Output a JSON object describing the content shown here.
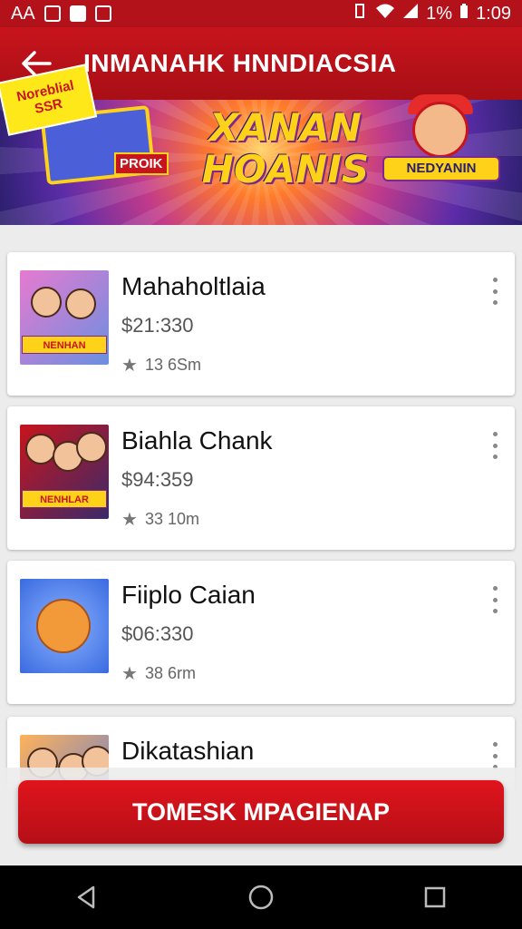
{
  "status_bar": {
    "left_text": "AA",
    "time": "1:09",
    "signal_text": "ᵴ",
    "battery_text": "1%"
  },
  "app_bar": {
    "title": "INMANAHK HNNDIACSIA"
  },
  "banner": {
    "tag_text": "Noreblial SSR",
    "title_line1": "XANAN",
    "title_line2": "HOANIS",
    "tv_label": "PROIK",
    "ribbon_text": "NEDYANIN",
    "colors": {
      "primary": "#c8141c",
      "gold": "#ffd21a",
      "purple": "#5b2ca8"
    }
  },
  "items": [
    {
      "title": "Mahaholtlaia",
      "price": "$21:330",
      "meta": "13 6Sm",
      "thumb_badge": "NENHAN",
      "thumb_bg": "#6b8fe0"
    },
    {
      "title": "Biahla Chank",
      "price": "$94:359",
      "meta": "33 10m",
      "thumb_badge": "NENHLAR",
      "thumb_bg": "#3a2a6a"
    },
    {
      "title": "Fiiplo Caian",
      "price": "$06:330",
      "meta": "38 6rm",
      "thumb_badge": "",
      "thumb_bg": "#3a6ae0"
    },
    {
      "title": "Dikatashian",
      "price": "",
      "meta": "",
      "thumb_badge": "",
      "thumb_bg": "#5a7ad8"
    }
  ],
  "cta": {
    "label": "TOMESK MPAGIENAP"
  },
  "nav": {
    "back_icon": "triangle-back-icon",
    "home_icon": "circle-home-icon",
    "recents_icon": "square-recents-icon"
  }
}
